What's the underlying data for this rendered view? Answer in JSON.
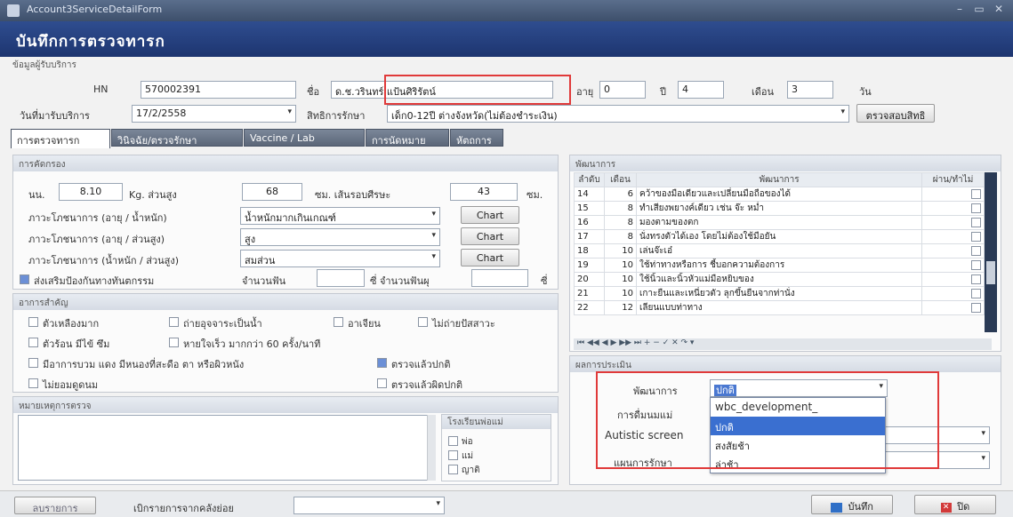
{
  "window": {
    "title": "Account3ServiceDetailForm",
    "min": "–",
    "max": "▭",
    "close": "✕"
  },
  "header": {
    "title": "บันทึกการตรวจทารก"
  },
  "patient": {
    "section": "ข้อมูลผู้รับบริการ",
    "hn_label": "HN",
    "hn": "570002391",
    "name_label": "ชื่อ",
    "name": "ด.ช.วรินทร์ แป้นศิริรัตน์",
    "age_label": "อายุ",
    "age_y": "0",
    "year_label": "ปี",
    "age_m": "4",
    "month_label": "เดือน",
    "age_d": "3",
    "day_label": "วัน",
    "date_label": "วันที่มารับบริการ",
    "date": "17/2/2558",
    "right_label": "สิทธิการรักษา",
    "right": "เด็ก0-12ปี ต่างจังหวัด(ไม่ต้องชำระเงิน)",
    "check_right": "ตรวจสอบสิทธิ"
  },
  "tabs": [
    "การตรวจทารก",
    "วินิจฉัย/ตรวจรักษา",
    "Vaccine / Lab",
    "การนัดหมาย",
    "หัตถการ"
  ],
  "screening": {
    "section": "การคัดกรอง",
    "weight_label": "นน.",
    "weight": "8.10",
    "kg_height": "Kg. ส่วนสูง",
    "height": "68",
    "cm_head": "ซม. เส้นรอบศีรษะ",
    "head": "43",
    "cm": "ซม.",
    "nut1_label": "ภาวะโภชนาการ (อายุ / น้ำหนัก)",
    "nut1": "น้ำหนักมากเกินเกณฑ์",
    "nut2_label": "ภาวะโภชนาการ (อายุ / ส่วนสูง)",
    "nut2": "สูง",
    "nut3_label": "ภาวะโภชนาการ (น้ำหนัก / ส่วนสูง)",
    "nut3": "สมส่วน",
    "chart": "Chart",
    "dental_label": "ส่งเสริมป้องกันทางทันตกรรม",
    "teeth_label": "จำนวนฟัน",
    "teeth_unit": "ซี่",
    "decay_label": "ซี่ จำนวนฟันผุ",
    "decay_unit": "ซี่"
  },
  "symptoms": {
    "section": "อาการสำคัญ",
    "items": [
      "ตัวเหลืองมาก",
      "ถ่ายอุจจาระเป็นน้ำ",
      "อาเจียน",
      "ไม่ถ่ายปัสสาวะ",
      "ตัวร้อน มีไข้ ซึม",
      "หายใจเร็ว มากกว่า 60 ครั้ง/นาที",
      "มีอาการบวม แดง มีหนองที่สะดือ ตา หรือผิวหนัง",
      "ตรวจแล้วปกติ",
      "ไม่ยอมดูดนม",
      "ตรวจแล้วผิดปกติ"
    ]
  },
  "notes": {
    "section": "หมายเหตุการตรวจ",
    "feed_label": "โรงเรียนพ่อแม่",
    "feed_items": [
      "พ่อ",
      "แม่",
      "ญาติ"
    ]
  },
  "development": {
    "section": "พัฒนาการ",
    "columns": [
      "ลำดับ",
      "เดือน",
      "พัฒนาการ",
      "ผ่าน/ทำไม่"
    ],
    "rows": [
      {
        "no": "14",
        "month": "6",
        "desc": "คว้าของมือเดียวและเปลี่ยนมือถือของได้"
      },
      {
        "no": "15",
        "month": "8",
        "desc": "ทำเสียงพยางค์เดียว เช่น จ๊ะ หม่ำ"
      },
      {
        "no": "16",
        "month": "8",
        "desc": "มองตามของตก"
      },
      {
        "no": "17",
        "month": "8",
        "desc": "นั่งทรงตัวได้เอง โดยไม่ต้องใช้มือยัน"
      },
      {
        "no": "18",
        "month": "10",
        "desc": "เล่นจ๊ะเอ๋"
      },
      {
        "no": "19",
        "month": "10",
        "desc": "ใช้ท่าทางหรือการ ชี้บอกความต้องการ"
      },
      {
        "no": "20",
        "month": "10",
        "desc": "ใช้นิ้วและนิ้วหัวแม่มือหยิบของ"
      },
      {
        "no": "21",
        "month": "10",
        "desc": "เกาะยืนและเหนี่ยวตัว ลุกขึ้นยืนจากท่านั่ง"
      },
      {
        "no": "22",
        "month": "12",
        "desc": "เลียนแบบท่าทาง"
      }
    ],
    "nav": "⏮ ◀◀ ◀ ▶ ▶▶ ⏭ + − ✓ ✕ ↷ ▾"
  },
  "evaluation": {
    "section": "ผลการประเมิน",
    "dev_label": "พัฒนาการ",
    "dev_value": "ปกติ",
    "breast_label": "การดื่มนมแม่",
    "autistic_label": "Autistic screen",
    "plan_label": "แผนการรักษา",
    "options": [
      "wbc_development_",
      "ปกติ",
      "สงสัยช้า",
      "ล่าช้า"
    ],
    "selected": 1
  },
  "footer": {
    "list_button": "ลบรายการ",
    "pull_label": "เบิกรายการจากคลังย่อย",
    "save": "บันทึก",
    "close": "ปิด"
  }
}
